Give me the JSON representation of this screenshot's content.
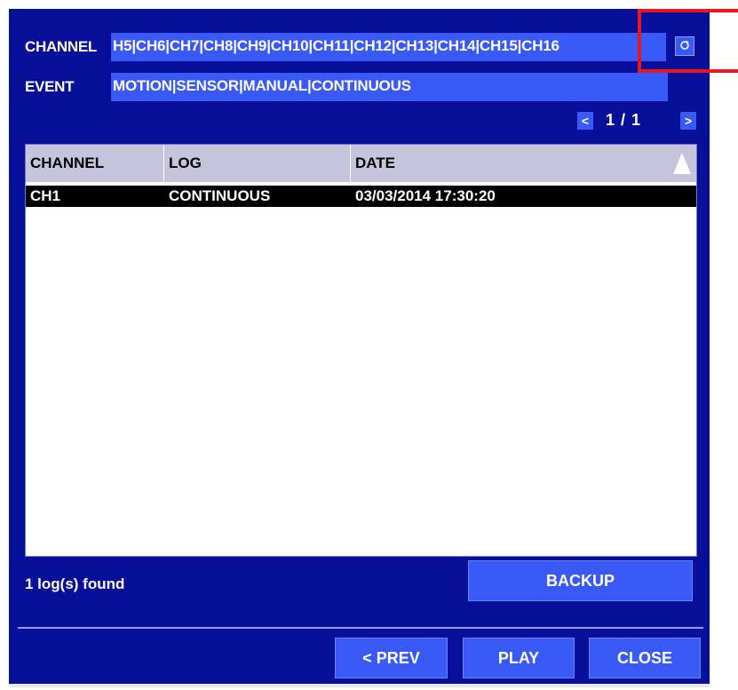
{
  "filter": {
    "channel_label": "CHANNEL",
    "channel_value": "H5|CH6|CH7|CH8|CH9|CH10|CH11|CH12|CH13|CH14|CH15|CH16",
    "channel_button_icon": "scroll-icon",
    "event_label": "EVENT",
    "event_value": "MOTION|SENSOR|MANUAL|CONTINUOUS"
  },
  "pagination": {
    "prev_symbol": "<",
    "next_symbol": ">",
    "text": "1 / 1"
  },
  "table": {
    "headers": [
      "CHANNEL",
      "LOG",
      "DATE"
    ],
    "sort_icon": "sort-ascending-icon",
    "rows": [
      [
        "CH1",
        "CONTINUOUS",
        "03/03/2014 17:30:20"
      ]
    ]
  },
  "status": {
    "found_text": "1 log(s) found"
  },
  "buttons": {
    "backup": "BACKUP",
    "prev": "< PREV",
    "play": "PLAY",
    "close": "CLOSE"
  },
  "colors": {
    "panel_bg": "#08109a",
    "field_bg": "#3a5af7",
    "highlight": "#e8161e",
    "selected_row": "#000000",
    "header_bg": "#c4c4dc"
  }
}
